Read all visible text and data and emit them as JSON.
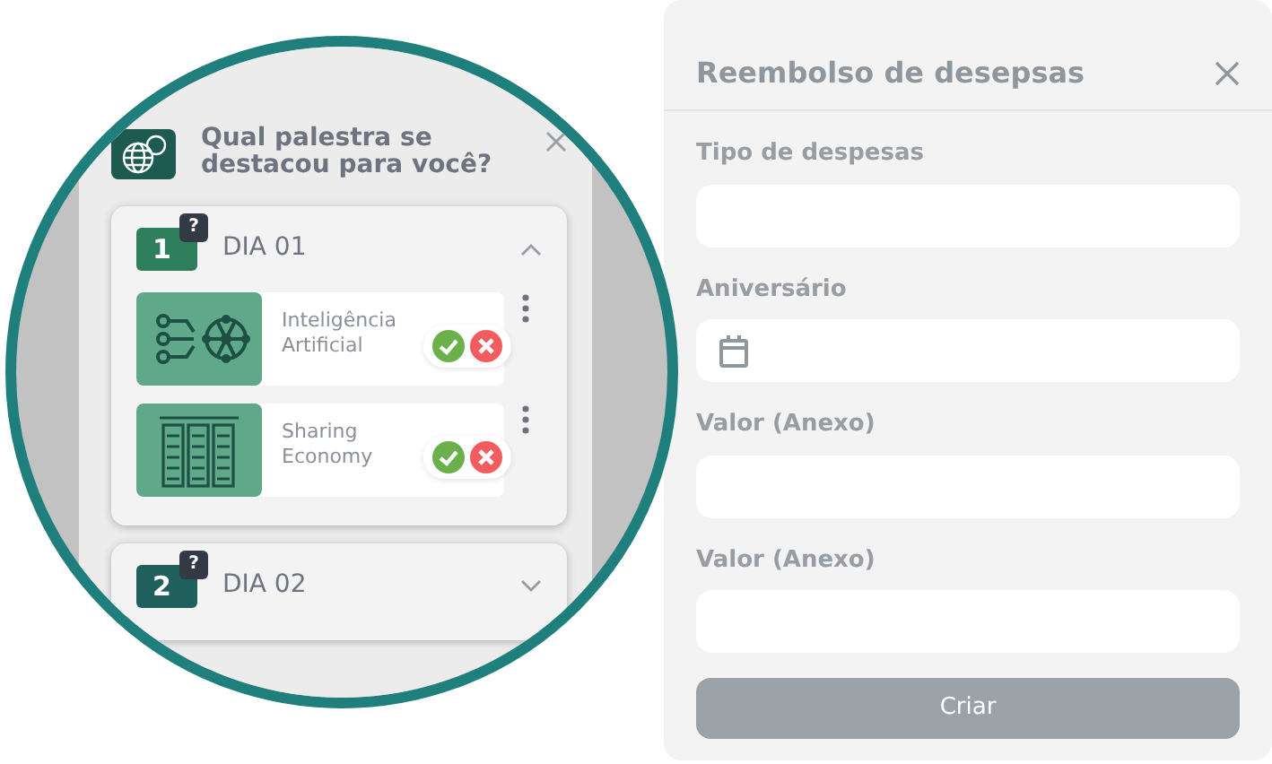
{
  "modal": {
    "title": "Qual palestra se destacou para você?",
    "days": [
      {
        "number": "1",
        "badge": "?",
        "label": "DIA 01",
        "expanded": true,
        "talks": [
          {
            "title": "Inteligência Artificial",
            "kind": "network"
          },
          {
            "title": "Sharing Economy",
            "kind": "servers"
          }
        ]
      },
      {
        "number": "2",
        "badge": "?",
        "label": "DIA 02",
        "expanded": false
      }
    ]
  },
  "form": {
    "title": "Reembolso de desepsas",
    "fields": [
      {
        "label": "Tipo de despesas",
        "kind": "text"
      },
      {
        "label": "Aniversário",
        "kind": "date"
      },
      {
        "label": "Valor (Anexo)",
        "kind": "text"
      },
      {
        "label": "Valor (Anexo)",
        "kind": "text"
      }
    ],
    "submit": "Criar"
  }
}
